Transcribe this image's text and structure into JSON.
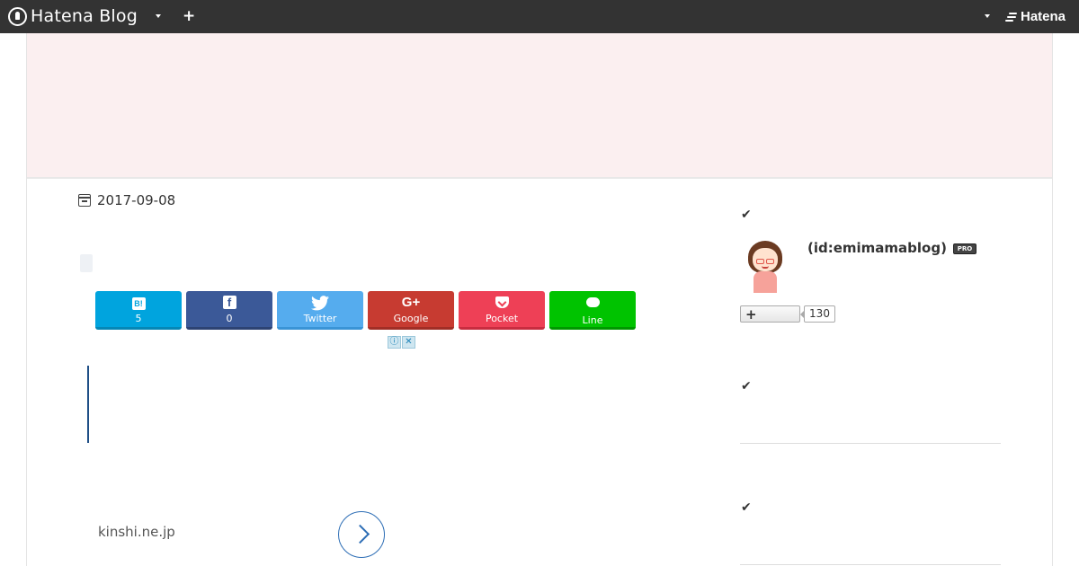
{
  "topbar": {
    "logo_text": "Hatena Blog",
    "brand_text": "Hatena",
    "add_label": "+",
    "bg_color": "#333333"
  },
  "banner": {
    "bg_color": "#fbeff0"
  },
  "article": {
    "date": "2017-09-08",
    "share_buttons": [
      {
        "service": "Hatena Bookmark",
        "icon": "B!",
        "label": "5",
        "color": "#00a4de"
      },
      {
        "service": "Facebook",
        "icon": "f",
        "label": "0",
        "color": "#3b5998"
      },
      {
        "service": "Twitter",
        "icon": "twitter-bird",
        "label": "Twitter",
        "color": "#55acee"
      },
      {
        "service": "Google+",
        "icon": "G+",
        "label": "Google",
        "color": "#c73b31"
      },
      {
        "service": "Pocket",
        "icon": "pocket",
        "label": "Pocket",
        "color": "#ee4056"
      },
      {
        "service": "LINE",
        "icon": "line",
        "label": "Line",
        "color": "#00c300"
      }
    ],
    "ad_info_icon": "ⓘ",
    "ad_close_icon": "✕",
    "ad_domain": "kinshi.ne.jp"
  },
  "sidebar": {
    "check_icon": "✔",
    "profile_id": "(id:emimamablog)",
    "pro_badge": "PRO",
    "follow_button_icon": "+",
    "follow_count": "130"
  }
}
